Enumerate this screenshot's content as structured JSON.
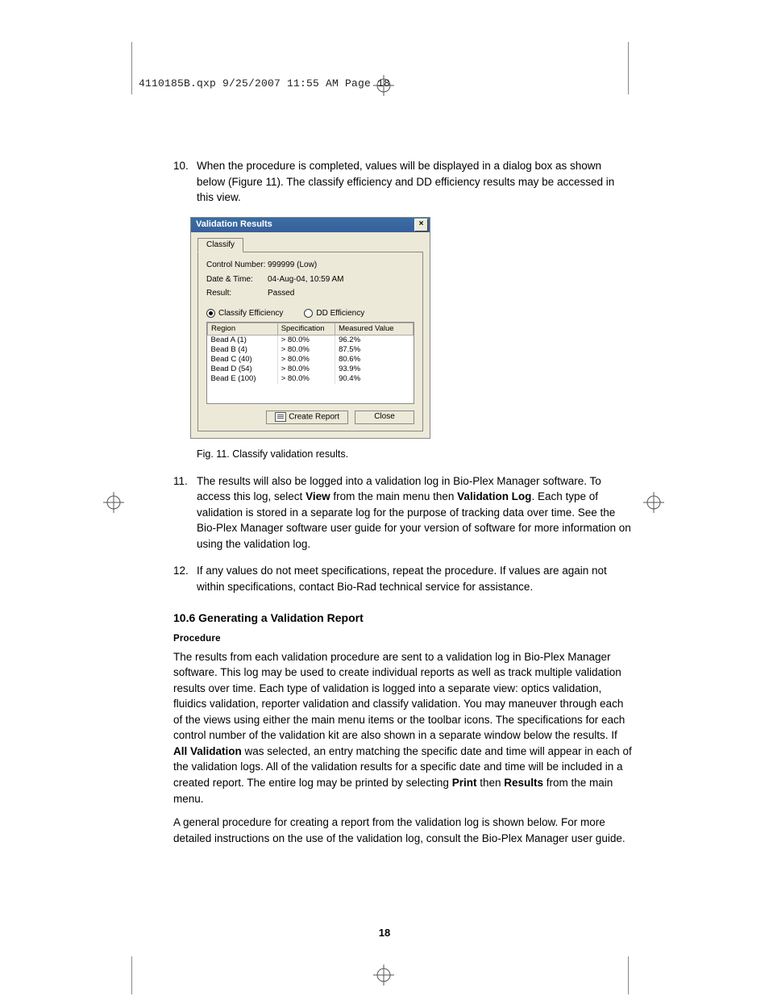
{
  "header_line": "4110185B.qxp  9/25/2007  11:55 AM  Page 18",
  "page_number": "18",
  "items": {
    "n10": {
      "num": "10.",
      "body": "When the procedure is completed, values will be displayed in a dialog box as shown below (Figure 11). The classify efficiency and DD efficiency results may be accessed in this view."
    },
    "n11": {
      "num": "11.",
      "pre": "The results will also be logged into a validation log in Bio-Plex Manager software. To access this log, select ",
      "b1": "View",
      "mid1": " from the main menu then ",
      "b2": "Validation Log",
      "post": ". Each type of validation is stored in a separate log for the purpose of tracking data over time. See the Bio-Plex Manager software user guide for your version of software for more information on using the validation log."
    },
    "n12": {
      "num": "12.",
      "body": " If any values do not meet specifications, repeat the procedure. If values are again not within specifications, contact Bio-Rad technical service for assistance."
    }
  },
  "fig_caption": "Fig. 11.  Classify validation results.",
  "section_head": "10.6  Generating a Validation Report",
  "proc_head": "Procedure",
  "para1": {
    "pre": "The results from each validation procedure are sent to a validation log in Bio-Plex Manager software. This log may be used to create individual reports as well as track multiple validation results over time. Each type of validation is logged into a separate view: optics validation, fluidics validation, reporter validation and classify validation. You may maneuver through each of the views using either the main menu items or the toolbar icons. The specifications for each control number of the validation kit are also shown in a separate window below the results. If ",
    "b1": "All Validation",
    "mid1": " was selected, an entry matching the specific date and time will appear in each of the validation logs. All of the validation results for a specific date and time will be included in a created report. The entire log may be printed by selecting ",
    "b2": "Print",
    "mid2": " then ",
    "b3": "Results",
    "post": " from the main menu."
  },
  "para2": "A general procedure for creating a report from the validation log is shown below. For more detailed instructions on the use of the validation log, consult the Bio-Plex Manager user guide.",
  "dialog": {
    "title": "Validation Results",
    "tab": "Classify",
    "kv": {
      "ctrl_k": "Control Number:",
      "ctrl_v": "999999 (Low)",
      "dt_k": "Date & Time:",
      "dt_v": "04-Aug-04, 10:59 AM",
      "res_k": "Result:",
      "res_v": "Passed"
    },
    "opt": {
      "a": "Classify Efficiency",
      "b": "DD Efficiency"
    },
    "cols": {
      "a": "Region",
      "b": "Specification",
      "c": "Measured Value"
    },
    "rows": [
      {
        "a": "Bead A (1)",
        "b": "> 80.0%",
        "c": "96.2%"
      },
      {
        "a": "Bead B (4)",
        "b": "> 80.0%",
        "c": "87.5%"
      },
      {
        "a": "Bead C (40)",
        "b": "> 80.0%",
        "c": "80.6%"
      },
      {
        "a": "Bead D (54)",
        "b": "> 80.0%",
        "c": "93.9%"
      },
      {
        "a": "Bead E (100)",
        "b": "> 80.0%",
        "c": "90.4%"
      }
    ],
    "btn_report": "Create Report",
    "btn_close": "Close"
  }
}
